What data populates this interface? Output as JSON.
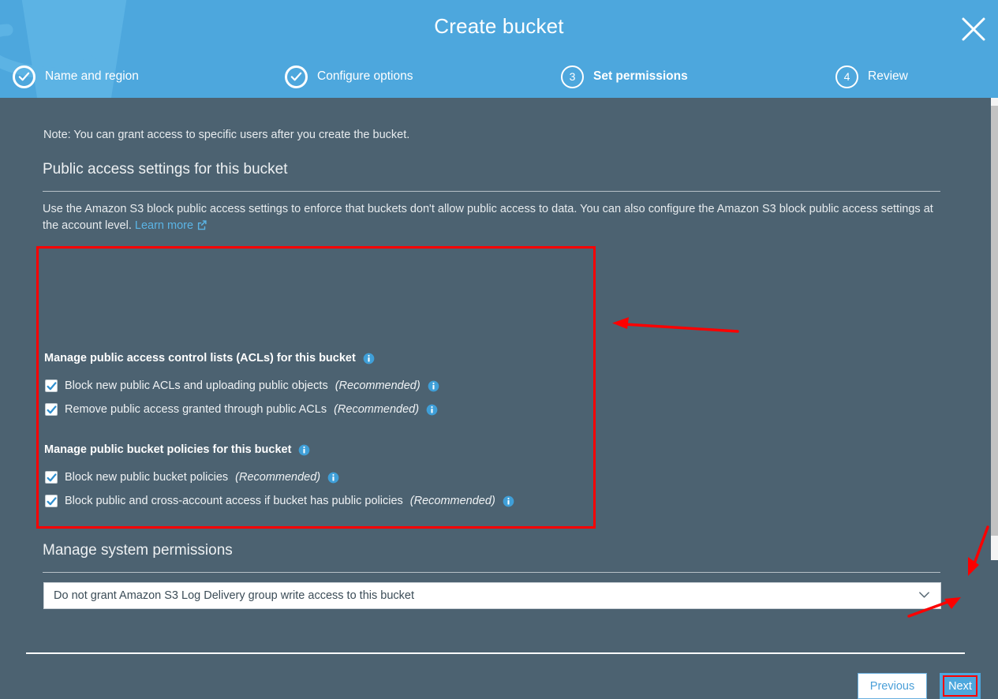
{
  "header": {
    "title": "Create bucket",
    "close_icon": "close-icon",
    "watermark_icon": "bucket-watermark-icon",
    "background_color": "#4da7dd",
    "steps": [
      {
        "id": "name-and-region",
        "number": "1",
        "label": "Name and region",
        "state": "completed",
        "icon": "check-circle-icon"
      },
      {
        "id": "configure-options",
        "number": "2",
        "label": "Configure options",
        "state": "completed",
        "icon": "check-circle-icon"
      },
      {
        "id": "set-permissions",
        "number": "3",
        "label": "Set permissions",
        "state": "current",
        "icon": "number-circle-icon"
      },
      {
        "id": "review",
        "number": "4",
        "label": "Review",
        "state": "upcoming",
        "icon": "number-circle-icon"
      }
    ]
  },
  "body": {
    "background_color": "#4c6271",
    "note": "Note: You can grant access to specific users after you create the bucket.",
    "public_access": {
      "heading": "Public access settings for this bucket",
      "intro_before_link": "Use the Amazon S3 block public access settings to enforce that buckets don't allow public access to data. You can also configure the Amazon S3 block public access settings at the account level. ",
      "learn_more_label": "Learn more",
      "learn_more_icon": "external-link-icon",
      "info_icon": "info-icon",
      "groups": [
        {
          "id": "manage-acls",
          "title": "Manage public access control lists (ACLs) for this bucket",
          "options": [
            {
              "id": "block-new-public-acls",
              "label": "Block new public ACLs and uploading public objects",
              "recommended": "(Recommended)",
              "checked": true
            },
            {
              "id": "remove-public-access-acls",
              "label": "Remove public access granted through public ACLs",
              "recommended": "(Recommended)",
              "checked": true
            }
          ]
        },
        {
          "id": "manage-bucket-policies",
          "title": "Manage public bucket policies for this bucket",
          "options": [
            {
              "id": "block-new-public-bucket-policies",
              "label": "Block new public bucket policies",
              "recommended": "(Recommended)",
              "checked": true
            },
            {
              "id": "block-cross-account-access",
              "label": "Block public and cross-account access if bucket has public policies",
              "recommended": "(Recommended)",
              "checked": true
            }
          ]
        }
      ]
    },
    "system_permissions": {
      "heading": "Manage system permissions",
      "log_delivery_select": {
        "value": "Do not grant Amazon S3 Log Delivery group write access to this bucket",
        "chevron_icon": "chevron-down-icon"
      }
    }
  },
  "footer": {
    "previous_label": "Previous",
    "next_label": "Next"
  },
  "annotations": {
    "highlight_color": "#fc0000",
    "arrows": [
      {
        "id": "arrow-to-acl-box",
        "direction": "left"
      },
      {
        "id": "arrow-to-next-top",
        "direction": "down-left"
      },
      {
        "id": "arrow-to-next-bot",
        "direction": "up-right"
      }
    ],
    "boxes": [
      {
        "id": "acl-highlight-box"
      },
      {
        "id": "next-highlight-box"
      }
    ]
  },
  "scrollbar": {
    "orientation": "vertical",
    "thumb_color": "#c2c2c2",
    "track_color": "#f4f4f4"
  }
}
